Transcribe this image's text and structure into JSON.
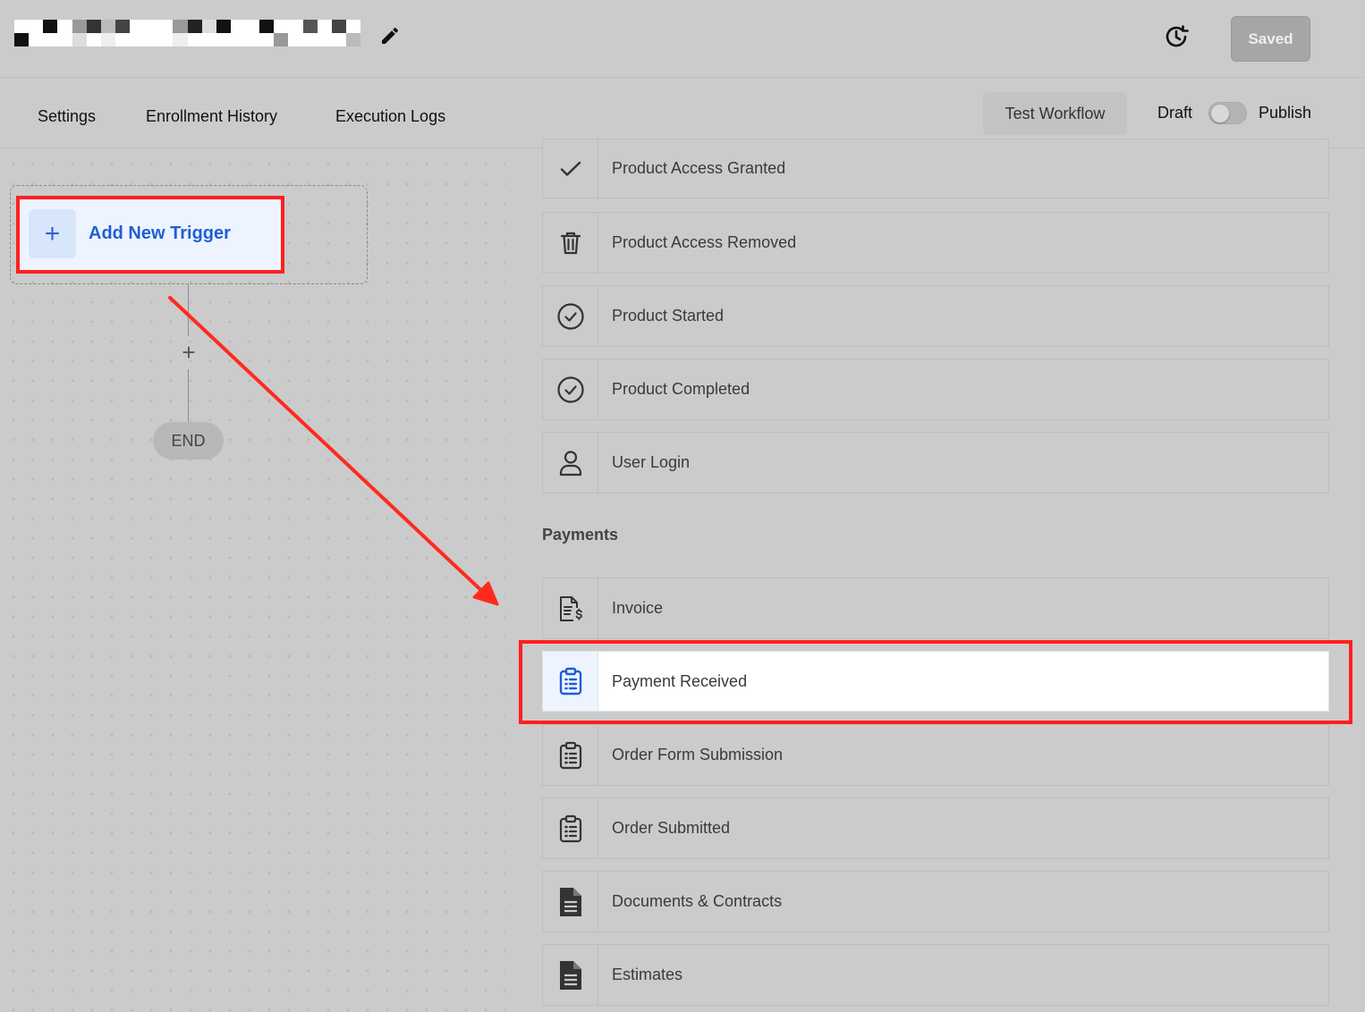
{
  "header": {
    "title_redacted": true,
    "saved_label": "Saved"
  },
  "nav": {
    "tabs": [
      {
        "label": "Settings"
      },
      {
        "label": "Enrollment History"
      },
      {
        "label": "Execution Logs"
      }
    ],
    "test_workflow_label": "Test Workflow",
    "draft_label": "Draft",
    "publish_label": "Publish",
    "published": false
  },
  "canvas": {
    "add_trigger_label": "Add New Trigger",
    "end_label": "END"
  },
  "panel": {
    "items_top": [
      {
        "label": "Product Access Granted",
        "icon": "check-icon"
      },
      {
        "label": "Product Access Removed",
        "icon": "trash-icon"
      },
      {
        "label": "Product Started",
        "icon": "check-circle-icon"
      },
      {
        "label": "Product Completed",
        "icon": "check-circle-icon"
      },
      {
        "label": "User Login",
        "icon": "user-icon"
      }
    ],
    "payments_title": "Payments",
    "payments_items": [
      {
        "label": "Invoice",
        "icon": "invoice-icon"
      },
      {
        "label": "Payment Received",
        "icon": "clipboard-list-icon",
        "selected": true
      },
      {
        "label": "Order Form Submission",
        "icon": "clipboard-list-icon"
      },
      {
        "label": "Order Submitted",
        "icon": "clipboard-list-icon"
      },
      {
        "label": "Documents & Contracts",
        "icon": "document-icon"
      },
      {
        "label": "Estimates",
        "icon": "document-icon"
      }
    ]
  },
  "colors": {
    "accent_blue": "#1f5ed6",
    "annotation_red": "#ff1f1f",
    "background": "#cbcbcb"
  }
}
